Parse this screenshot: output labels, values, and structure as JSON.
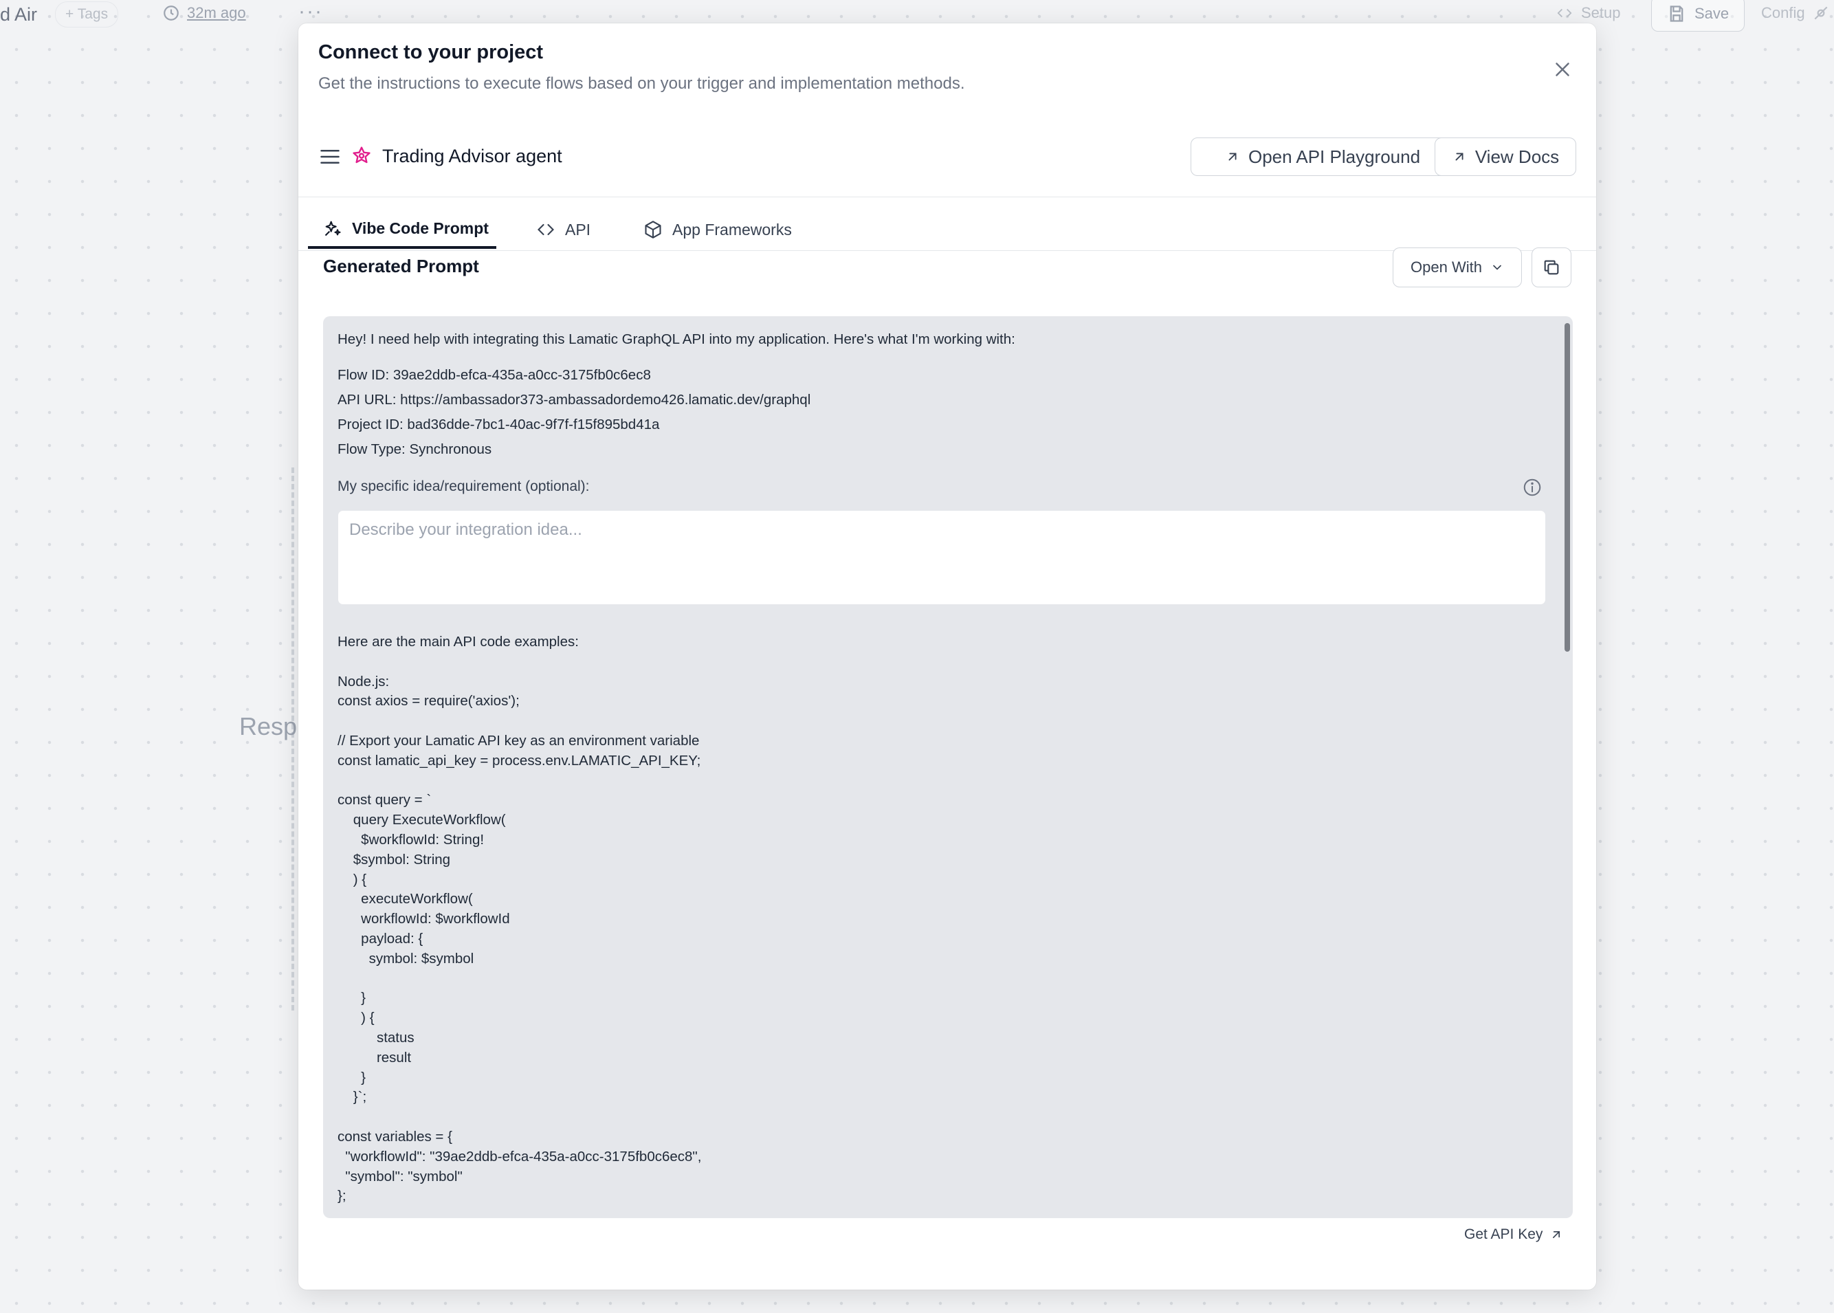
{
  "background": {
    "title": "d Air",
    "tags_label": "+ Tags",
    "time_label": "32m ago",
    "more_label": "···",
    "setup_label": "Setup",
    "save_label": "Save",
    "config_label": "Config",
    "canvas_label": "Resp"
  },
  "modal": {
    "title": "Connect to your project",
    "subtitle": "Get the instructions to execute flows based on your trigger and implementation methods.",
    "agent_name": "Trading Advisor agent",
    "open_playground_label": "Open API Playground",
    "view_docs_label": "View Docs",
    "tabs": [
      {
        "label": "Vibe Code Prompt",
        "active": true
      },
      {
        "label": "API",
        "active": false
      },
      {
        "label": "App Frameworks",
        "active": false
      }
    ],
    "generated_prompt_title": "Generated Prompt",
    "open_with_label": "Open With",
    "prompt": {
      "intro": "Hey! I need help with integrating this Lamatic GraphQL API into my application. Here's what I'm working with:",
      "details": "Flow ID: 39ae2ddb-efca-435a-a0cc-3175fb0c6ec8\nAPI URL: https://ambassador373-ambassadordemo426.lamatic.dev/graphql\nProject ID: bad36dde-7bc1-40ac-9f7f-f15f895bd41a\nFlow Type: Synchronous",
      "requirement_label": "My specific idea/requirement (optional):",
      "requirement_placeholder": "Describe your integration idea...",
      "requirement_value": "",
      "code": "Here are the main API code examples:\n\nNode.js:\nconst axios = require('axios');\n\n// Export your Lamatic API key as an environment variable\nconst lamatic_api_key = process.env.LAMATIC_API_KEY;\n\nconst query = `\n    query ExecuteWorkflow(\n      $workflowId: String!\n    $symbol: String\n    ) {\n      executeWorkflow(\n      workflowId: $workflowId\n      payload: {\n        symbol: $symbol\n\n      }\n      ) {\n          status\n          result\n      }\n    }`;\n\nconst variables = {\n  \"workflowId\": \"39ae2ddb-efca-435a-a0cc-3175fb0c6ec8\",\n  \"symbol\": \"symbol\"\n};"
    },
    "get_api_key_label": "Get API Key",
    "colors": {
      "brand_icon": "#e11d8c",
      "prompt_bg": "#e5e7eb",
      "active_tab": "#111827"
    },
    "icons": {
      "close": "close-icon",
      "menu": "menu-icon",
      "agent": "agent-star-icon",
      "external": "arrow-up-right-icon",
      "sparkles": "sparkles-icon",
      "code": "code-icon",
      "cube": "cube-icon",
      "chevron": "chevron-down-icon",
      "copy": "copy-icon",
      "info": "info-icon"
    }
  }
}
